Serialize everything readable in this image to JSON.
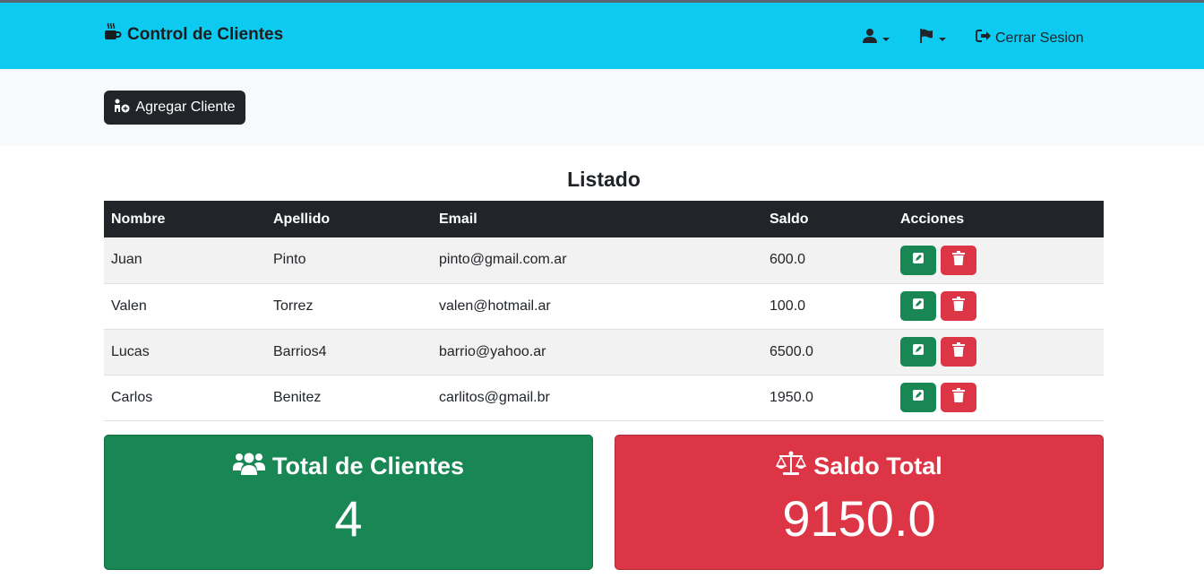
{
  "navbar": {
    "brand_icon": "mug-hot-icon",
    "brand": "Control de Clientes",
    "user_icon": "user-icon",
    "flag_icon": "flag-icon",
    "logout_icon": "sign-out-icon",
    "logout_label": "Cerrar Sesion"
  },
  "actions": {
    "add_icon": "user-plus-icon",
    "add_label": "Agregar Cliente"
  },
  "list": {
    "title": "Listado",
    "columns": [
      "Nombre",
      "Apellido",
      "Email",
      "Saldo",
      "Acciones"
    ],
    "rows": [
      {
        "nombre": "Juan",
        "apellido": "Pinto",
        "email": "pinto@gmail.com.ar",
        "saldo": "600.0"
      },
      {
        "nombre": "Valen",
        "apellido": "Torrez",
        "email": "valen@hotmail.ar",
        "saldo": "100.0"
      },
      {
        "nombre": "Lucas",
        "apellido": "Barrios4",
        "email": "barrio@yahoo.ar",
        "saldo": "6500.0"
      },
      {
        "nombre": "Carlos",
        "apellido": "Benitez",
        "email": "carlitos@gmail.br",
        "saldo": "1950.0"
      }
    ]
  },
  "summary": {
    "clients": {
      "icon": "users-icon",
      "title": "Total de Clientes",
      "value": "4"
    },
    "balance": {
      "icon": "balance-scale-icon",
      "title": "Saldo Total",
      "value": "9150.0"
    }
  },
  "colors": {
    "navbar": "#0dcaf0",
    "dark": "#212529",
    "success": "#198754",
    "danger": "#dc3545"
  }
}
